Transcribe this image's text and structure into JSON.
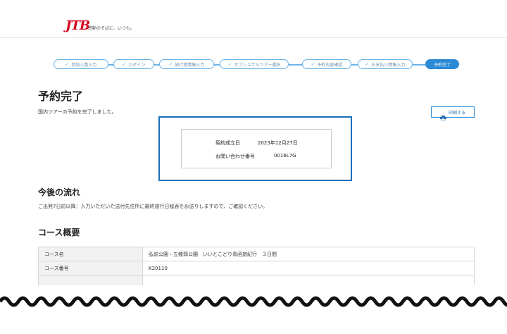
{
  "header": {
    "logo": "JTB",
    "tagline": "感動のそばに、いつも。"
  },
  "steps": [
    {
      "label": "参加人数入力",
      "done": true
    },
    {
      "label": "ログイン",
      "done": true
    },
    {
      "label": "旅行者情報入力",
      "done": true
    },
    {
      "label": "オプショナルツアー選択",
      "done": true
    },
    {
      "label": "予約内容確認",
      "done": true
    },
    {
      "label": "お支払い情報入力",
      "done": true
    },
    {
      "label": "予約完了",
      "done": false,
      "active": true
    }
  ],
  "page": {
    "title": "予約完了",
    "subtitle": "国内ツアーの予約を完了しました。",
    "print_label": "印刷する"
  },
  "confirmation": {
    "date_label": "契約成立日",
    "date_value": "2023年12月27日",
    "inquiry_label": "お問い合わせ番号",
    "inquiry_value": "0016L7G"
  },
  "next_steps": {
    "heading": "今後の流れ",
    "text": "ご出発7日前以降：入力いただいた送付先住所に最終旅行日程表をお送りしますので、ご確認ください。"
  },
  "course": {
    "heading": "コース概要",
    "rows": [
      {
        "label": "コース名",
        "value": "弘前公園・五稜郭公園　いいとこどり青函旅紀行　３日間"
      },
      {
        "label": "コース番号",
        "value": "K20110"
      }
    ]
  },
  "colors": {
    "accent": "#2b8ad5",
    "brand": "#d6001c"
  }
}
